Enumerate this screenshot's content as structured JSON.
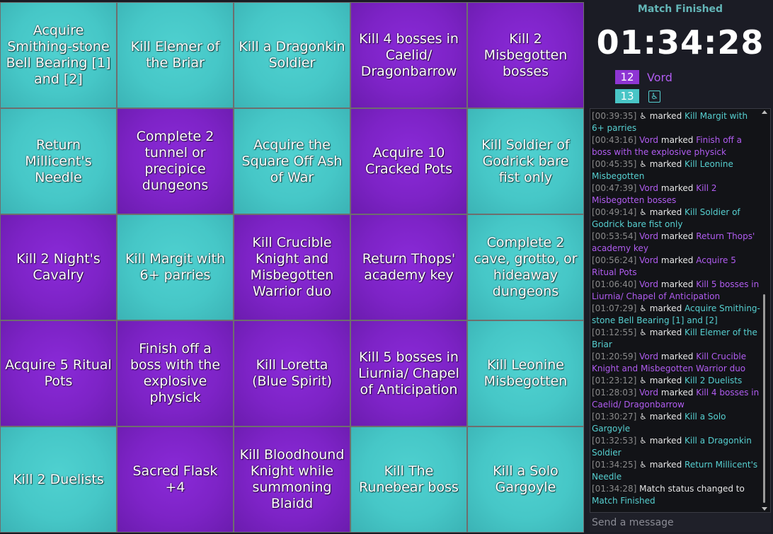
{
  "board": {
    "cells": [
      {
        "text": "Acquire Smithing-stone Bell Bearing [1] and [2]",
        "color": "teal"
      },
      {
        "text": "Kill Elemer of the Briar",
        "color": "teal"
      },
      {
        "text": "Kill a Dragonkin Soldier",
        "color": "teal"
      },
      {
        "text": "Kill 4 bosses in Caelid/ Dragonbarrow",
        "color": "purple"
      },
      {
        "text": "Kill 2 Misbegotten bosses",
        "color": "purple"
      },
      {
        "text": "Return Millicent's Needle",
        "color": "teal"
      },
      {
        "text": "Complete 2 tunnel or precipice dungeons",
        "color": "purple"
      },
      {
        "text": "Acquire the Square Off Ash of War",
        "color": "teal"
      },
      {
        "text": "Acquire 10 Cracked Pots",
        "color": "purple"
      },
      {
        "text": "Kill Soldier of Godrick bare fist only",
        "color": "teal"
      },
      {
        "text": "Kill 2 Night's Cavalry",
        "color": "purple"
      },
      {
        "text": "Kill Margit with 6+ parries",
        "color": "teal"
      },
      {
        "text": "Kill Crucible Knight and Misbegotten Warrior duo",
        "color": "purple"
      },
      {
        "text": "Return Thops' academy key",
        "color": "purple"
      },
      {
        "text": "Complete 2 cave, grotto, or hideaway dungeons",
        "color": "teal"
      },
      {
        "text": "Acquire 5 Ritual Pots",
        "color": "purple"
      },
      {
        "text": "Finish off a boss with the explosive physick",
        "color": "purple"
      },
      {
        "text": "Kill Loretta (Blue Spirit)",
        "color": "purple"
      },
      {
        "text": "Kill 5 bosses in Liurnia/ Chapel of Anticipation",
        "color": "purple"
      },
      {
        "text": "Kill Leonine Misbegotten",
        "color": "teal"
      },
      {
        "text": "Kill 2 Duelists",
        "color": "teal"
      },
      {
        "text": "Sacred Flask +4",
        "color": "purple"
      },
      {
        "text": "Kill Bloodhound Knight while summoning Blaidd",
        "color": "purple"
      },
      {
        "text": "Kill The Runebear boss",
        "color": "teal"
      },
      {
        "text": "Kill a Solo Gargoyle",
        "color": "teal"
      }
    ],
    "colors": {
      "teal": "#46c7c7",
      "purple": "#7d23c6"
    }
  },
  "side": {
    "status": "Match Finished",
    "timer": "01:34:28",
    "players": [
      {
        "score": "12",
        "name": "Vord",
        "color": "#8e35d3"
      },
      {
        "score": "13",
        "name": "",
        "icon": "wheelchair-icon",
        "color": "#49c5c6"
      }
    ]
  },
  "chat": {
    "messages": [
      {
        "ts": "[00:39:35]",
        "who": "p2",
        "action": "marked",
        "goal": "Kill Margit with 6+ parries"
      },
      {
        "ts": "[00:43:16]",
        "who": "p1",
        "action": "marked",
        "goal": "Finish off a boss with the explosive physick"
      },
      {
        "ts": "[00:45:35]",
        "who": "p2",
        "action": "marked",
        "goal": "Kill Leonine Misbegotten"
      },
      {
        "ts": "[00:47:39]",
        "who": "p1",
        "action": "marked",
        "goal": "Kill 2 Misbegotten bosses"
      },
      {
        "ts": "[00:49:14]",
        "who": "p2",
        "action": "marked",
        "goal": "Kill Soldier of Godrick bare fist only"
      },
      {
        "ts": "[00:53:54]",
        "who": "p1",
        "action": "marked",
        "goal": "Return Thops' academy key"
      },
      {
        "ts": "[00:56:24]",
        "who": "p1",
        "action": "marked",
        "goal": "Acquire 5 Ritual Pots"
      },
      {
        "ts": "[01:06:40]",
        "who": "p1",
        "action": "marked",
        "goal": "Kill 5 bosses in Liurnia/ Chapel of Anticipation"
      },
      {
        "ts": "[01:07:29]",
        "who": "p2",
        "action": "marked",
        "goal": "Acquire Smithing-stone Bell Bearing [1] and [2]"
      },
      {
        "ts": "[01:12:55]",
        "who": "p2",
        "action": "marked",
        "goal": "Kill Elemer of the Briar"
      },
      {
        "ts": "[01:20:59]",
        "who": "p1",
        "action": "marked",
        "goal": "Kill Crucible Knight and Misbegotten Warrior duo"
      },
      {
        "ts": "[01:23:12]",
        "who": "p2",
        "action": "marked",
        "goal": "Kill 2 Duelists"
      },
      {
        "ts": "[01:28:03]",
        "who": "p1",
        "action": "marked",
        "goal": "Kill 4 bosses in Caelid/ Dragonbarrow"
      },
      {
        "ts": "[01:30:27]",
        "who": "p2",
        "action": "marked",
        "goal": "Kill a Solo Gargoyle"
      },
      {
        "ts": "[01:32:53]",
        "who": "p2",
        "action": "marked",
        "goal": "Kill a Dragonkin Soldier"
      },
      {
        "ts": "[01:34:25]",
        "who": "p2",
        "action": "marked",
        "goal": "Return Millicent's Needle"
      },
      {
        "ts": "[01:34:28]",
        "who": "sys",
        "action": "Match status changed to",
        "goal": "Match Finished"
      }
    ],
    "input_placeholder": "Send a message"
  }
}
